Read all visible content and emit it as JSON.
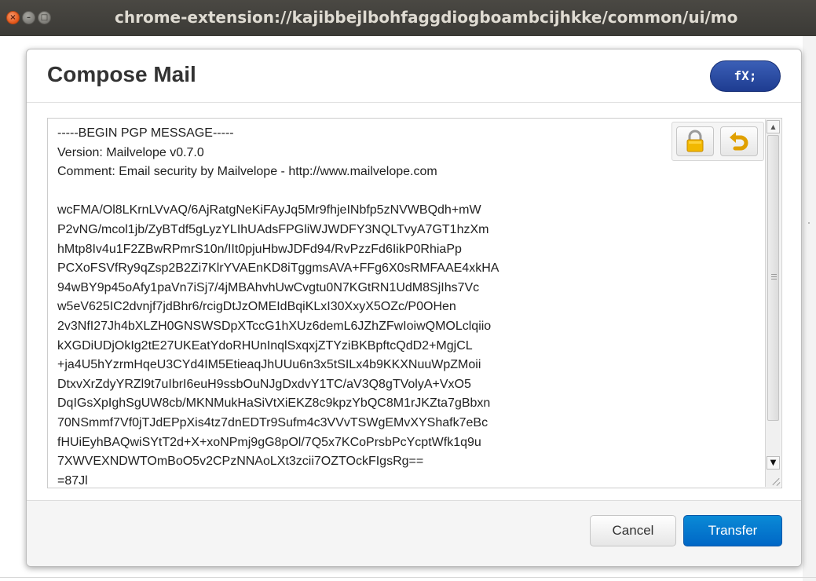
{
  "window": {
    "title": "chrome-extension://kajibbejlbohfaggdiogboambcijhkke/common/ui/mo",
    "controls": {
      "close_glyph": "×",
      "minimize_glyph": "–",
      "maximize_glyph": "□"
    }
  },
  "dialog": {
    "title": "Compose Mail",
    "badge": "fX;"
  },
  "editor": {
    "content": "-----BEGIN PGP MESSAGE-----\nVersion: Mailvelope v0.7.0\nComment: Email security by Mailvelope - http://www.mailvelope.com\n\nwcFMA/Ol8LKrnLVvAQ/6AjRatgNeKiFAyJq5Mr9fhjeINbfp5zNVWBQdh+mW\nP2vNG/mcol1jb/ZyBTdf5gLyzYLIhUAdsFPGliWJWDFY3NQLTvyA7GT1hzXm\nhMtp8Iv4u1F2ZBwRPmrS10n/IIt0pjuHbwJDFd94/RvPzzFd6IikP0RhiaPp\nPCXoFSVfRy9qZsp2B2Zi7KlrYVAEnKD8iTggmsAVA+FFg6X0sRMFAAE4xkHA\n94wBY9p45oAfy1paVn7iSj7/4jMBAhvhUwCvgtu0N7KGtRN1UdM8SjIhs7Vc\nw5eV625IC2dvnjf7jdBhr6/rcigDtJzOMEIdBqiKLxI30XxyX5OZc/P0OHen\n2v3NfI27Jh4bXLZH0GNSWSDpXTccG1hXUz6demL6JZhZFwIoiwQMOLclqiio\nkXGDiUDjOkIg2tE27UKEatYdoRHUnInqlSxqxjZTYziBKBpftcQdD2+MgjCL\n+ja4U5hYzrmHqeU3CYd4IM5EtieaqJhUUu6n3x5tSILx4b9KKXNuuWpZMoii\nDtxvXrZdyYRZl9t7uIbrI6euH9ssbOuNJgDxdvY1TC/aV3Q8gTVolyA+VxO5\nDqIGsXpIghSgUW8cb/MKNMukHaSiVtXiEKZ8c9kpzYbQC8M1rJKZta7gBbxn\n70NSmmf7Vf0jTJdEPpXis4tz7dnEDTr9Sufm4c3VVvTSWgEMvXYShafk7eBc\nfHUiEyhBAQwiSYtT2d+X+xoNPmj9gG8pOl/7Q5x7KCoPrsbPcYcptWfk1q9u\n7XWVEXNDWTOmBoO5v2CPzNNAoLXt3zcii7OZTOckFIgsRg==\n=87Jl",
    "tools": {
      "lock_icon": "lock-icon",
      "undo_icon": "undo-icon"
    }
  },
  "footer": {
    "cancel_label": "Cancel",
    "transfer_label": "Transfer"
  },
  "colors": {
    "primary_button": "#0a78d2",
    "badge": "#2a4aa4",
    "titlebar": "#3c3b37",
    "close_button": "#e25518"
  }
}
